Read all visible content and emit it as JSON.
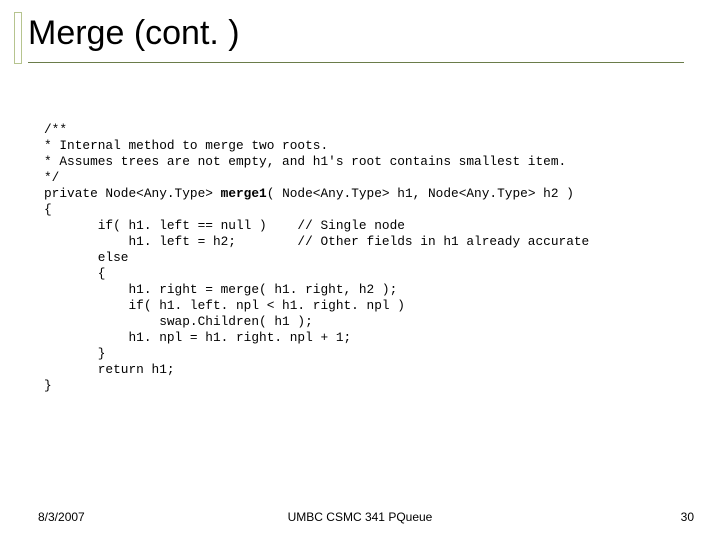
{
  "title": "Merge (cont. )",
  "code": "/**\n* Internal method to merge two roots.\n* Assumes trees are not empty, and h1's root contains smallest item.\n*/\nprivate Node<Any.Type> merge1( Node<Any.Type> h1, Node<Any.Type> h2 )\n{\n       if( h1. left == null )    // Single node\n           h1. left = h2;        // Other fields in h1 already accurate\n       else\n       {\n           h1. right = merge( h1. right, h2 );\n           if( h1. left. npl < h1. right. npl )\n               swap.Children( h1 );\n           h1. npl = h1. right. npl + 1;\n       }\n       return h1;\n}",
  "bold_token": "merge1",
  "footer": {
    "date": "8/3/2007",
    "center": "UMBC CSMC 341 PQueue",
    "page": "30"
  }
}
